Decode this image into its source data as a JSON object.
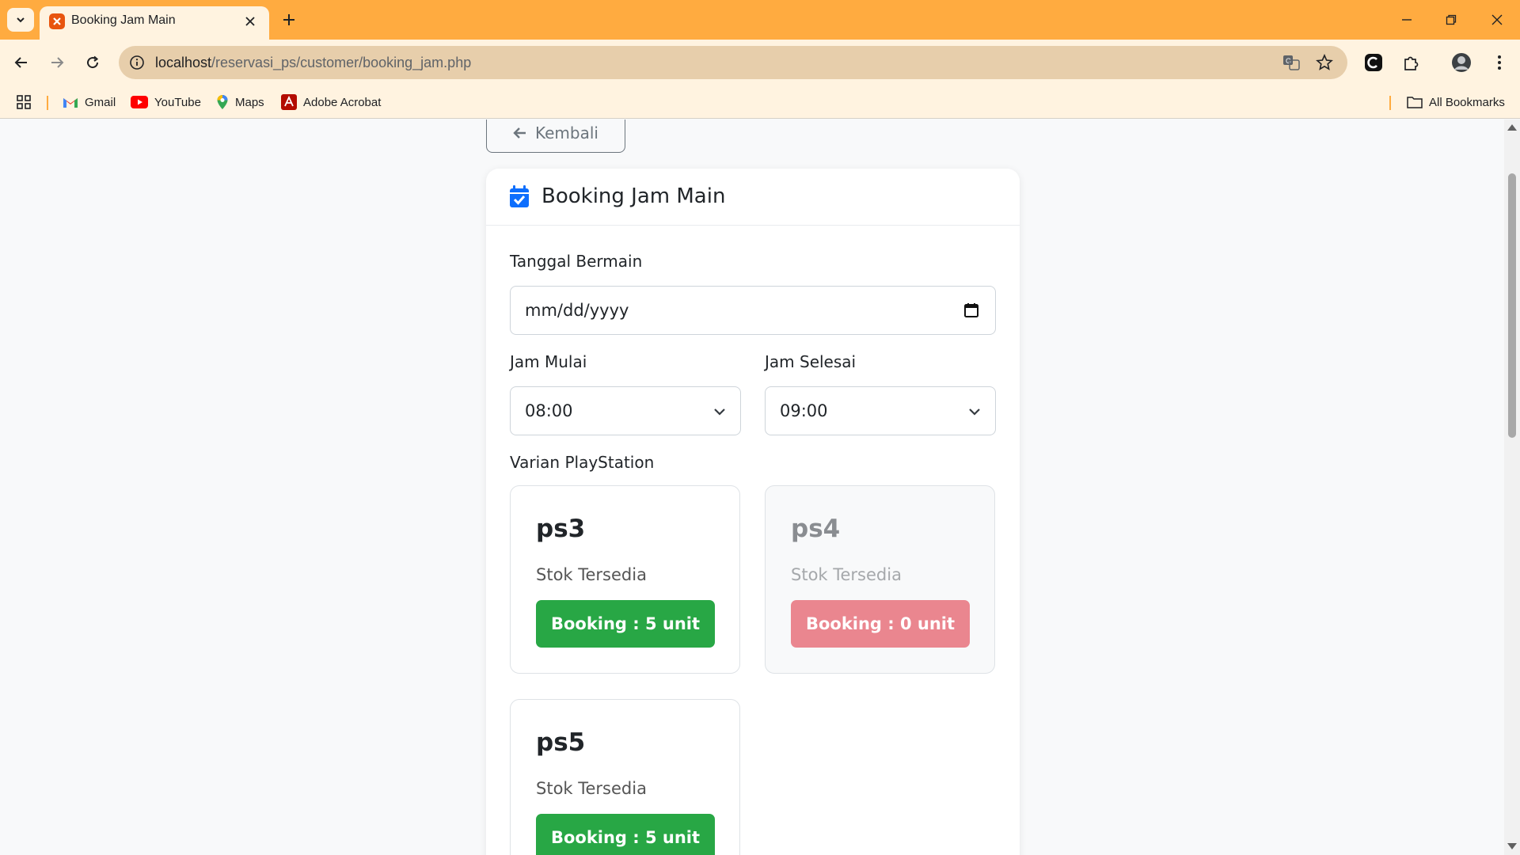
{
  "browser": {
    "tab_title": "Booking Jam Main",
    "url_host": "localhost",
    "url_path": "/reservasi_ps/customer/booking_jam.php",
    "accent_color": "#ffab40"
  },
  "bookmarks": {
    "items": [
      {
        "label": "Gmail",
        "icon": "gmail-icon"
      },
      {
        "label": "YouTube",
        "icon": "youtube-icon"
      },
      {
        "label": "Maps",
        "icon": "maps-icon"
      },
      {
        "label": "Adobe Acrobat",
        "icon": "adobe-acrobat-icon"
      }
    ],
    "all_bookmarks": "All Bookmarks"
  },
  "page": {
    "back_label": "Kembali",
    "card_title": "Booking Jam Main",
    "date_label": "Tanggal Bermain",
    "date_placeholder": "mm/dd/yyyy",
    "start_label": "Jam Mulai",
    "start_value": "08:00",
    "end_label": "Jam Selesai",
    "end_value": "09:00",
    "variant_label": "Varian PlayStation",
    "variants": [
      {
        "name": "ps3",
        "stock": "Stok Tersedia",
        "button": "Booking : 5 unit",
        "available": true
      },
      {
        "name": "ps4",
        "stock": "Stok Tersedia",
        "button": "Booking : 0 unit",
        "available": false
      },
      {
        "name": "ps5",
        "stock": "Stok Tersedia",
        "button": "Booking : 5 unit",
        "available": true
      }
    ],
    "colors": {
      "primary": "#0d6efd",
      "success": "#28a745",
      "danger_light": "#ea868f"
    }
  }
}
